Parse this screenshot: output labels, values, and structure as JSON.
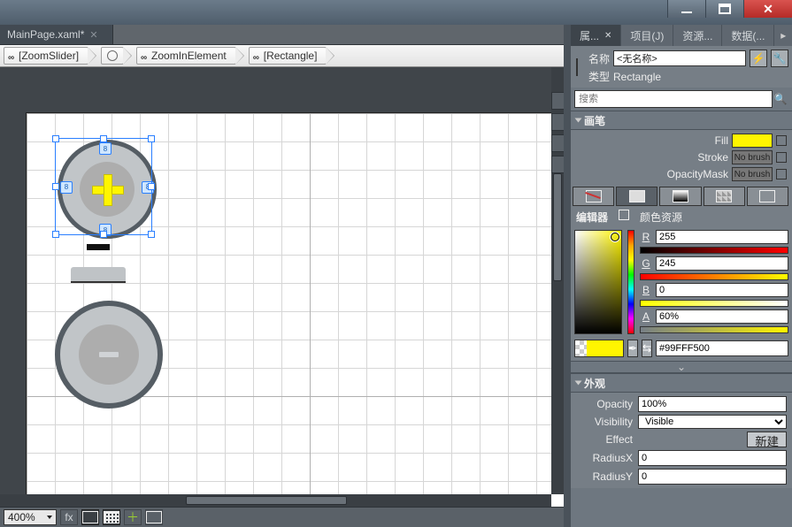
{
  "window": {
    "min_label": "minimize",
    "max_label": "maximize",
    "close_label": "close"
  },
  "document_tab": {
    "title": "MainPage.xaml*",
    "close_hint": "x"
  },
  "breadcrumb": [
    {
      "label": "[ZoomSlider]"
    },
    {
      "label": "ZoomInElement"
    },
    {
      "label": "[Rectangle]"
    }
  ],
  "status": {
    "zoom": "400%"
  },
  "right_tabs": {
    "properties": "属...",
    "project": "项目(J)",
    "resources": "资源...",
    "data": "数据(..."
  },
  "object": {
    "name_label": "名称",
    "name_value": "<无名称>",
    "type_label": "类型",
    "type_value": "Rectangle"
  },
  "search": {
    "placeholder": "搜索"
  },
  "sections": {
    "brush": "画笔",
    "appearance": "外观"
  },
  "brush": {
    "fill_label": "Fill",
    "fill_color": "#FFF500",
    "stroke_label": "Stroke",
    "stroke_value": "No brush",
    "opacitymask_label": "OpacityMask",
    "opacitymask_value": "No brush"
  },
  "picker": {
    "editor_tab": "编辑器",
    "resource_tab": "颜色资源",
    "r_label": "R",
    "r_value": "255",
    "g_label": "G",
    "g_value": "245",
    "b_label": "B",
    "b_value": "0",
    "a_label": "A",
    "a_value": "60%",
    "hex": "#99FFF500"
  },
  "appearance": {
    "opacity_label": "Opacity",
    "opacity_value": "100%",
    "visibility_label": "Visibility",
    "visibility_value": "Visible",
    "effect_label": "Effect",
    "effect_new": "新建",
    "radiusx_label": "RadiusX",
    "radiusx_value": "0",
    "radiusy_label": "RadiusY",
    "radiusy_value": "0"
  }
}
